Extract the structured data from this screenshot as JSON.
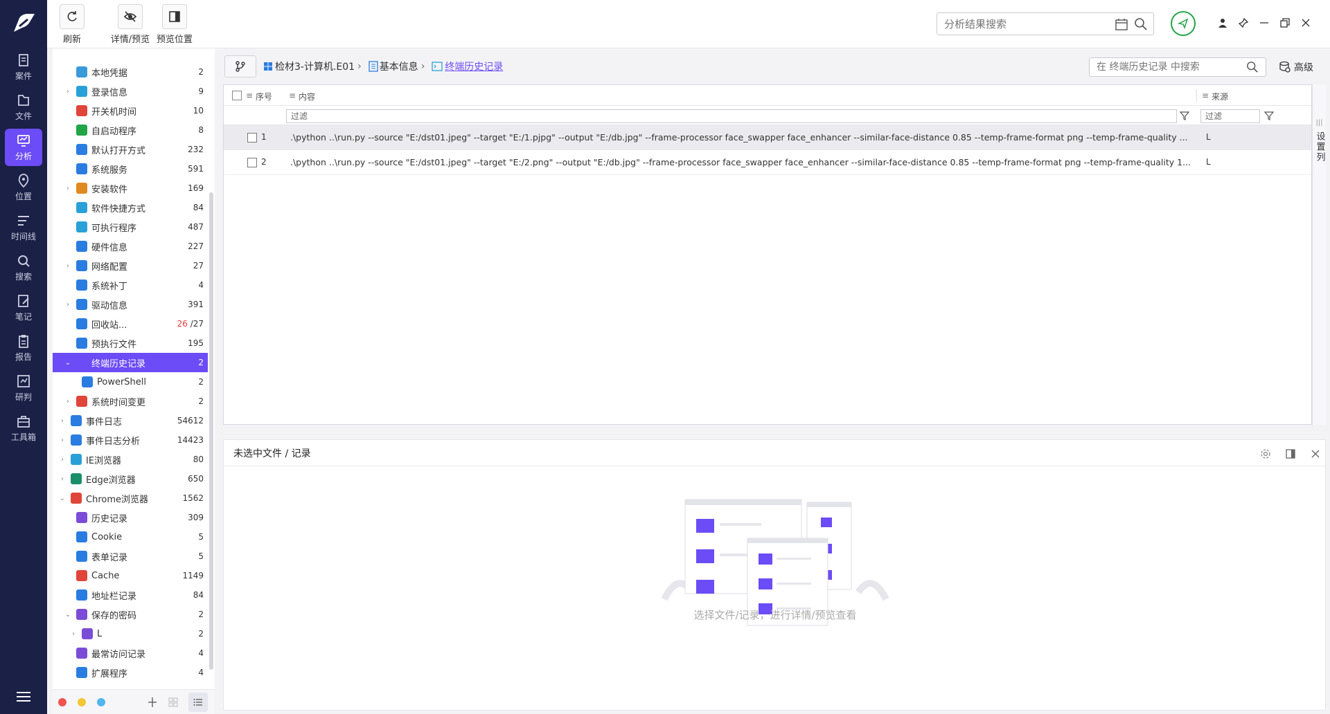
{
  "rail": {
    "items": [
      {
        "label": "案件",
        "icon": "case-icon"
      },
      {
        "label": "文件",
        "icon": "file-icon"
      },
      {
        "label": "分析",
        "icon": "analysis-icon",
        "active": true
      },
      {
        "label": "位置",
        "icon": "location-icon"
      },
      {
        "label": "时间线",
        "icon": "timeline-icon"
      },
      {
        "label": "搜索",
        "icon": "search-icon"
      },
      {
        "label": "笔记",
        "icon": "note-icon"
      },
      {
        "label": "报告",
        "icon": "report-icon"
      },
      {
        "label": "研判",
        "icon": "judge-icon"
      },
      {
        "label": "工具箱",
        "icon": "toolbox-icon"
      }
    ]
  },
  "toolbar": {
    "refresh_label": "刷新",
    "detail_preview_label": "详情/预览",
    "preview_position_label": "预览位置"
  },
  "global_search": {
    "placeholder": "分析结果搜索"
  },
  "tree": {
    "items": [
      {
        "label": "本地凭据",
        "count": "2",
        "color": "#3a9ad9",
        "indent": 1,
        "chev": ""
      },
      {
        "label": "登录信息",
        "count": "9",
        "color": "#2aa0d8",
        "indent": 1,
        "chev": ">"
      },
      {
        "label": "开关机时间",
        "count": "10",
        "color": "#e0453a",
        "indent": 1,
        "chev": ""
      },
      {
        "label": "自启动程序",
        "count": "8",
        "color": "#22a447",
        "indent": 1,
        "chev": ""
      },
      {
        "label": "默认打开方式",
        "count": "232",
        "color": "#2a7ce0",
        "indent": 1,
        "chev": ""
      },
      {
        "label": "系统服务",
        "count": "591",
        "color": "#2a7ce0",
        "indent": 1,
        "chev": ""
      },
      {
        "label": "安装软件",
        "count": "169",
        "color": "#e08a22",
        "indent": 1,
        "chev": ">"
      },
      {
        "label": "软件快捷方式",
        "count": "84",
        "color": "#2aa0d8",
        "indent": 1,
        "chev": ""
      },
      {
        "label": "可执行程序",
        "count": "487",
        "color": "#2aa0d8",
        "indent": 1,
        "chev": ""
      },
      {
        "label": "硬件信息",
        "count": "227",
        "color": "#2a7ce0",
        "indent": 1,
        "chev": ""
      },
      {
        "label": "网络配置",
        "count": "27",
        "color": "#2a7ce0",
        "indent": 1,
        "chev": ">"
      },
      {
        "label": "系统补丁",
        "count": "4",
        "color": "#2a7ce0",
        "indent": 1,
        "chev": ""
      },
      {
        "label": "驱动信息",
        "count": "391",
        "color": "#2a7ce0",
        "indent": 1,
        "chev": ">"
      },
      {
        "label": "回收站...",
        "count_red": "26",
        "count": "/27",
        "color": "#2a7ce0",
        "indent": 1,
        "chev": ""
      },
      {
        "label": "预执行文件",
        "count": "195",
        "color": "#2a7ce0",
        "indent": 1,
        "chev": ""
      },
      {
        "label": "终端历史记录",
        "count": "2",
        "color": "#6b4cf6",
        "indent": 1,
        "chev": "v",
        "selected": true
      },
      {
        "label": "PowerShell",
        "count": "2",
        "color": "#2a7ce0",
        "indent": 2,
        "chev": ""
      },
      {
        "label": "系统时间变更",
        "count": "2",
        "color": "#e0453a",
        "indent": 1,
        "chev": ">"
      },
      {
        "label": "事件日志",
        "count": "54612",
        "color": "#2a7ce0",
        "indent": 0,
        "chev": ">"
      },
      {
        "label": "事件日志分析",
        "count": "14423",
        "color": "#2a7ce0",
        "indent": 0,
        "chev": ">"
      },
      {
        "label": "IE浏览器",
        "count": "80",
        "color": "#2aa0d8",
        "indent": 0,
        "chev": ">"
      },
      {
        "label": "Edge浏览器",
        "count": "650",
        "color": "#1a8f6a",
        "indent": 0,
        "chev": ">"
      },
      {
        "label": "Chrome浏览器",
        "count": "1562",
        "color": "#e0453a",
        "indent": 0,
        "chev": "v"
      },
      {
        "label": "历史记录",
        "count": "309",
        "color": "#7b4cd6",
        "indent": 1,
        "chev": ""
      },
      {
        "label": "Cookie",
        "count": "5",
        "color": "#2a7ce0",
        "indent": 1,
        "chev": ""
      },
      {
        "label": "表单记录",
        "count": "5",
        "color": "#2a7ce0",
        "indent": 1,
        "chev": ""
      },
      {
        "label": "Cache",
        "count": "1149",
        "color": "#e0453a",
        "indent": 1,
        "chev": ""
      },
      {
        "label": "地址栏记录",
        "count": "84",
        "color": "#2a7ce0",
        "indent": 1,
        "chev": ""
      },
      {
        "label": "保存的密码",
        "count": "2",
        "color": "#7b4cd6",
        "indent": 1,
        "chev": "v"
      },
      {
        "label": "L",
        "count": "2",
        "color": "#7b4cd6",
        "indent": 2,
        "chev": ">"
      },
      {
        "label": "最常访问记录",
        "count": "4",
        "color": "#7b4cd6",
        "indent": 1,
        "chev": ""
      },
      {
        "label": "扩展程序",
        "count": "4",
        "color": "#2a7ce0",
        "indent": 1,
        "chev": ""
      }
    ]
  },
  "breadcrumb": {
    "items": [
      "检材3-计算机.E01",
      "基本信息",
      "终端历史记录"
    ]
  },
  "table_search": {
    "placeholder": "在 终端历史记录 中搜索",
    "advanced_label": "高级"
  },
  "table": {
    "columns": {
      "index": "序号",
      "content": "内容",
      "source": "来源"
    },
    "filter_placeholder": "过滤",
    "rows": [
      {
        "index": "1",
        "content": ".\\python ..\\run.py --source \"E:/dst01.jpeg\" --target \"E:/1.pjpg\" --output \"E:/db.jpg\" --frame-processor face_swapper face_enhancer --similar-face-distance 0.85 --temp-frame-format png --temp-frame-quality ...",
        "source": "L"
      },
      {
        "index": "2",
        "content": ".\\python ..\\run.py --source \"E:/dst01.jpeg\" --target \"E:/2.png\" --output \"E:/db.jpg\" --frame-processor face_swapper face_enhancer --similar-face-distance 0.85 --temp-frame-format png --temp-frame-quality 1...",
        "source": "L"
      }
    ],
    "side_label": "设置列"
  },
  "detail": {
    "title": "未选中文件 / 记录",
    "empty_text": "选择文件/记录，进行详情/预览查看"
  },
  "colors": {
    "accent": "#6b4cf6",
    "rail": "#1b2046"
  }
}
